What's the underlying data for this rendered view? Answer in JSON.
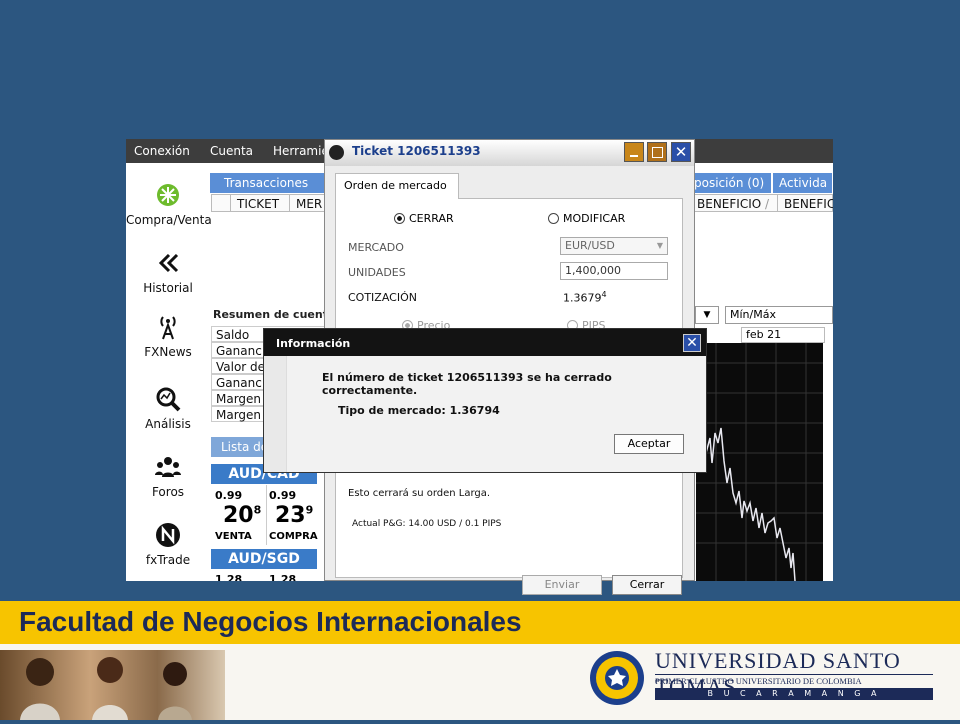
{
  "menu": [
    "Conexión",
    "Cuenta",
    "Herramie"
  ],
  "sidebar": {
    "items": [
      {
        "label": "Compra/Venta",
        "icon": "compra-venta-icon"
      },
      {
        "label": "Historial",
        "icon": "historial-icon"
      },
      {
        "label": "FXNews",
        "icon": "fxnews-icon"
      },
      {
        "label": "Análisis",
        "icon": "analysis-icon"
      },
      {
        "label": "Foros",
        "icon": "forums-icon"
      },
      {
        "label": "fxTrade",
        "icon": "fxtrade-icon"
      }
    ]
  },
  "tabs": {
    "left": "Transacciones (0)",
    "right1": "posición (0)",
    "right2": "Activida"
  },
  "columns": {
    "ticket": "TICKET",
    "mer": "MER",
    "beneficio1": "BENEFICIO",
    "beneficio2": "BENEFIC"
  },
  "account_summary": {
    "title": "Resumen de cuenta",
    "rows": [
      "Saldo",
      "Gananci",
      "Valor de",
      "Gananci",
      "Margen u",
      "Margen d"
    ]
  },
  "watchlist": {
    "title": "Lista de",
    "tiles": [
      {
        "pair": "AUD/CAD",
        "sell_prefix": "0.99",
        "sell_big": "20",
        "sell_sup": "8",
        "sell_label": "VENTA",
        "buy_prefix": "0.99",
        "buy_big": "23",
        "buy_sup": "9",
        "buy_label": "COMPRA"
      },
      {
        "pair": "AUD/SGD",
        "sell_prefix": "1.28",
        "buy_prefix": "1.28"
      }
    ]
  },
  "chart": {
    "range": "Mín/Máx",
    "date": "feb 21"
  },
  "ticket": {
    "title": "Ticket 1206511393",
    "tab": "Orden de mercado",
    "option_close": "CERRAR",
    "option_modify": "MODIFICAR",
    "market_label": "MERCADO",
    "market_value": "EUR/USD",
    "units_label": "UNIDADES",
    "units_value": "1,400,000",
    "quote_label": "COTIZACIÓN",
    "quote_value": "1.3679",
    "quote_sup": "4",
    "price_option": "Precio",
    "pips_option": "PIPS",
    "close_msg": "Esto cerrará su orden Larga.",
    "pl_msg": "Actual P&G: 14.00 USD / 0.1 PIPS",
    "send_button": "Enviar",
    "cancel_button": "Cerrar"
  },
  "info_dialog": {
    "title": "Información",
    "message": "El número de ticket 1206511393 se ha cerrado correctamente.",
    "detail": "Tipo de mercado: 1.36794",
    "accept_button": "Aceptar"
  },
  "footer": {
    "faculty": "Facultad de Negocios Internacionales",
    "university": "UNIVERSIDAD SANTO TOMAS",
    "subtitle": "PRIMER CLAUSTRO UNIVERSITARIO DE COLOMBIA",
    "city": "B U C A R A M A N G A"
  },
  "colors": {
    "accent": "#5a8ed6",
    "footer": "#f7c400",
    "slide_bg": "#2c5680"
  }
}
